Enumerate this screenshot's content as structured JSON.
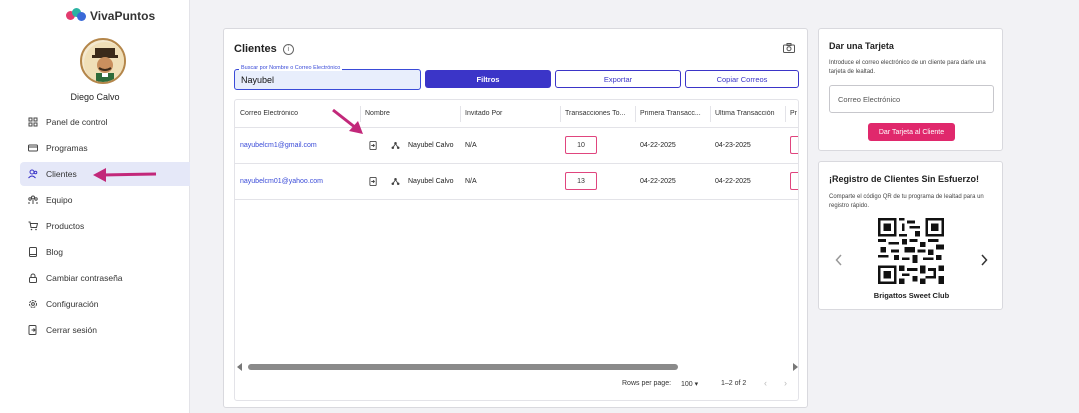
{
  "app": {
    "brand_name": "VivaPuntos",
    "user_name": "Diego Calvo"
  },
  "sidebar": {
    "items": [
      {
        "label": "Panel de control",
        "icon": "grid-icon",
        "active": false
      },
      {
        "label": "Programas",
        "icon": "card-icon",
        "active": false
      },
      {
        "label": "Clientes",
        "icon": "users-icon",
        "active": true
      },
      {
        "label": "Equipo",
        "icon": "team-icon",
        "active": false
      },
      {
        "label": "Productos",
        "icon": "cart-icon",
        "active": false
      },
      {
        "label": "Blog",
        "icon": "book-icon",
        "active": false
      },
      {
        "label": "Cambiar contraseña",
        "icon": "lock-icon",
        "active": false
      },
      {
        "label": "Configuración",
        "icon": "gear-icon",
        "active": false
      },
      {
        "label": "Cerrar sesión",
        "icon": "logout-icon",
        "active": false
      }
    ]
  },
  "clients": {
    "title": "Clientes",
    "search": {
      "label": "Buscar por Nombre o Correo Electrónico",
      "value": "Nayubel"
    },
    "buttons": {
      "filter": "Filtros",
      "export": "Exportar",
      "copy_emails": "Copiar Correos"
    },
    "columns": [
      "Correo Electrónico",
      "Nombre",
      "Invitado Por",
      "Transacciones To...",
      "Primera Transacc...",
      "Ultima Transacción",
      "Pr"
    ],
    "rows": [
      {
        "email": "nayubelcm1@gmail.com",
        "name": "Nayubel Calvo",
        "invited_by": "N/A",
        "transactions": "10",
        "first": "04-22-2025",
        "last": "04-23-2025"
      },
      {
        "email": "nayubelcm01@yahoo.com",
        "name": "Nayubel Calvo",
        "invited_by": "N/A",
        "transactions": "13",
        "first": "04-22-2025",
        "last": "04-22-2025"
      }
    ],
    "pagination": {
      "rows_label": "Rows per page:",
      "rows_value": "100",
      "range": "1–2 of 2"
    }
  },
  "give_card": {
    "title": "Dar una Tarjeta",
    "description": "Introduce el correo electrónico de un cliente para darle una tarjeta de lealtad.",
    "email_placeholder": "Correo Electrónico",
    "button": "Dar Tarjeta al Cliente"
  },
  "registration": {
    "title": "¡Registro de Clientes Sin Esfuerzo!",
    "description": "Comparte el código QR de tu programa de lealtad para un registro rápido.",
    "program_name": "Brigattos Sweet Club"
  },
  "colors": {
    "primary": "#3b35c8",
    "accent": "#e0286c",
    "annotation_arrow": "#c2287a"
  }
}
